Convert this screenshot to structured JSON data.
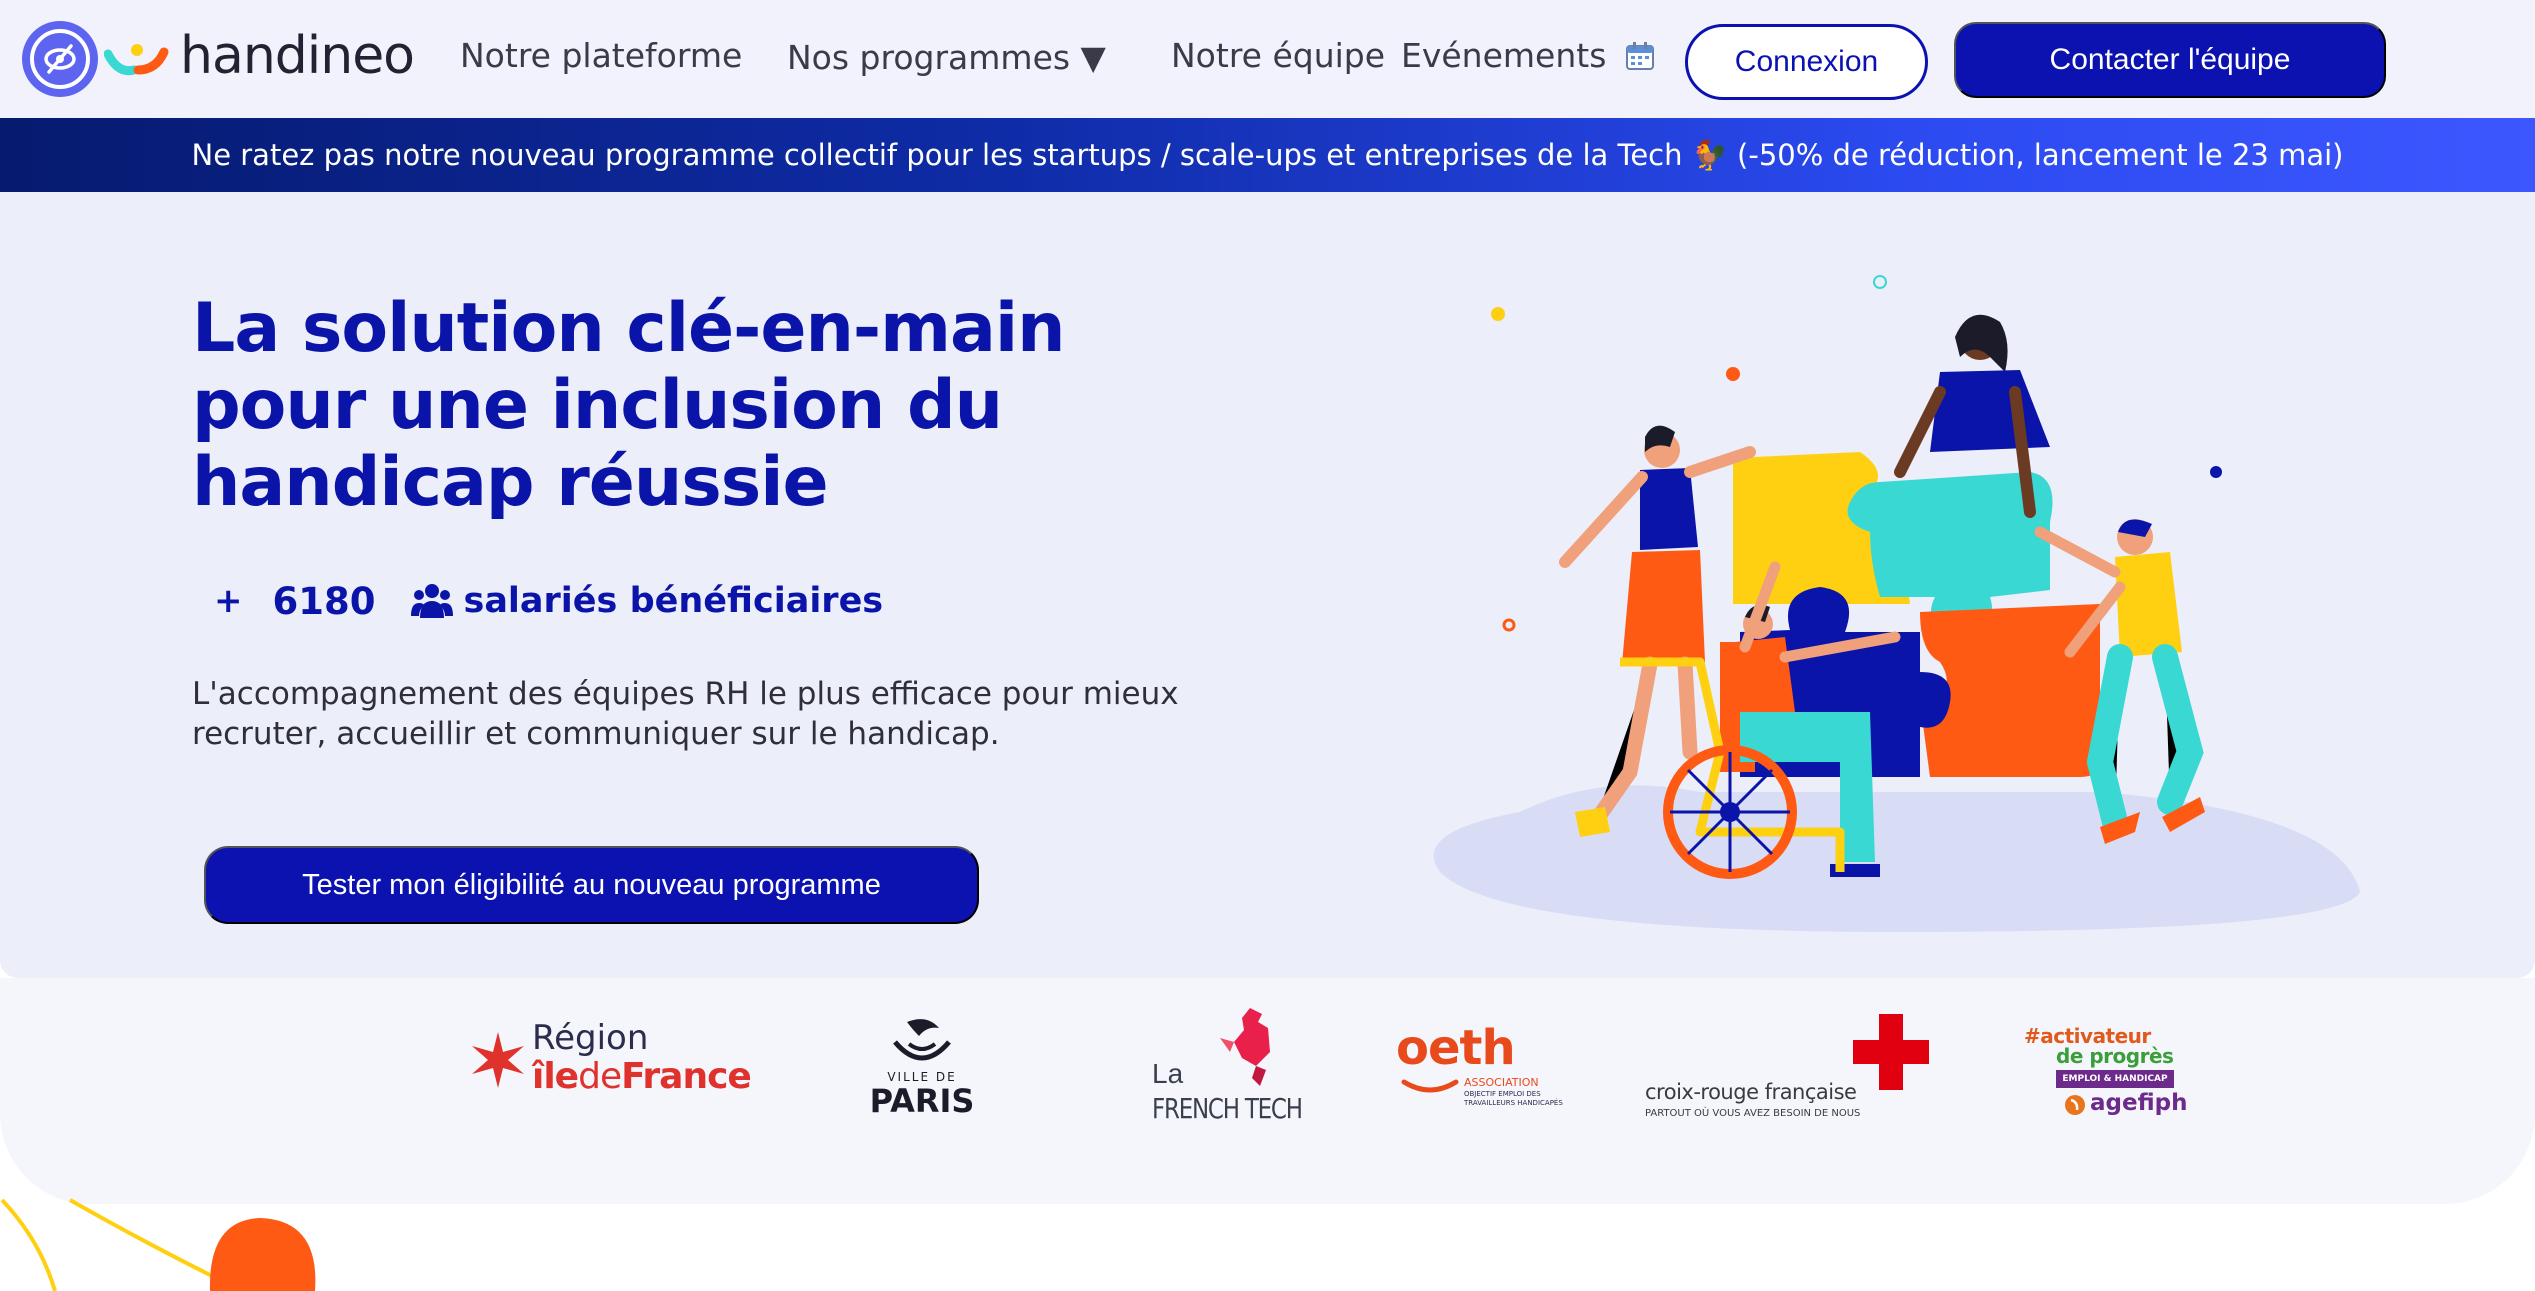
{
  "nav": {
    "logo_text": "handineo",
    "links": [
      "Notre plateforme",
      "Nos programmes ▼",
      "Notre équipe",
      "Evénements"
    ],
    "login_label": "Connexion",
    "contact_label": "Contacter l'équipe"
  },
  "banner": {
    "text": "Ne ratez pas notre nouveau programme collectif pour les startups / scale-ups et entreprises de la Tech 🐓 (-50% de réduction, lancement le 23 mai)"
  },
  "hero": {
    "title": "La solution clé-en-main pour une inclusion du handicap réussie",
    "stat_plus": "+",
    "stat_value": "6180",
    "stat_label": "salariés bénéficiaires",
    "description": "L'accompagnement des équipes RH le plus efficace pour mieux recruter, accueillir et communiquer sur le handicap.",
    "cta_label": "Tester mon éligibilité au nouveau programme"
  },
  "partners": {
    "idf_line1": "Région",
    "idf_line2a": "île",
    "idf_line2b": "de",
    "idf_line2c": "France",
    "paris_small": "VILLE DE",
    "paris_big": "PARIS",
    "ft_la": "La",
    "ft_text": "FRENCH TECH",
    "oeth_big": "oeth",
    "oeth_small": "ASSOCIATION",
    "oeth_tiny1": "OBJECTIF EMPLOI DES",
    "oeth_tiny2": "TRAVAILLEURS HANDICAPÉS",
    "crf_name": "croix-rouge française",
    "crf_tag": "PARTOUT OÙ VOUS AVEZ BESOIN DE NOUS",
    "ag_line1": "#activateur",
    "ag_line2": "de progrès",
    "ag_box": "EMPLOI & HANDICAP",
    "ag_brand": "agefiph"
  },
  "colors": {
    "primary": "#0b12b0",
    "hero_bg": "#eceefa",
    "accent_orange": "#ff5a14",
    "accent_yellow": "#ffd012",
    "accent_teal": "#3ad8d2"
  },
  "icons": {
    "logo": "eye-slash-icon",
    "calendar": "calendar-icon",
    "users": "users-icon"
  }
}
